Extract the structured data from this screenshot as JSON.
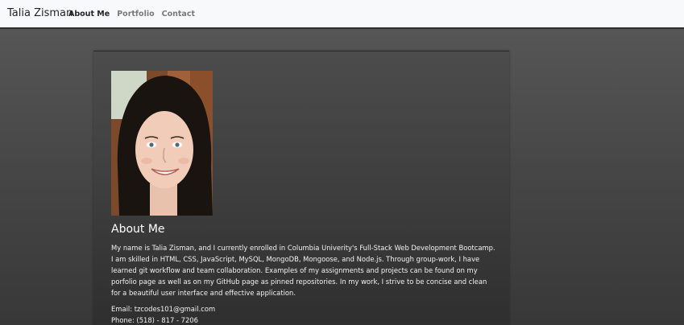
{
  "navbar": {
    "brand": "Talia Zisman",
    "links": [
      {
        "label": "About Me",
        "active": true
      },
      {
        "label": "Portfolio",
        "active": false
      },
      {
        "label": "Contact",
        "active": false
      }
    ]
  },
  "about": {
    "photo_icon": "profile-photo",
    "title": "About Me",
    "bio": "My name is Talia Zisman, and I currently enrolled in Columbia Univerity's Full-Stack Web Development Bootcamp. I am skilled in HTML, CSS, JavaScript, MySQL, MongoDB, Mongoose, and Node.js. Through group-work, I have learned git workflow and team collaboration. Examples of my assignments and projects can be found on my porfolio page as well as on my GitHub page as pinned repositories. In my work, I strive to be concise and clean for a beautiful user interface and effective application.",
    "email": "Email: tzcodes101@gmail.com",
    "phone": "Phone: (518) - 817 - 7206"
  },
  "colors": {
    "navbar_bg": "#f8f9fa",
    "page_bg": "#4a4a4a",
    "text_light": "#ffffff"
  }
}
